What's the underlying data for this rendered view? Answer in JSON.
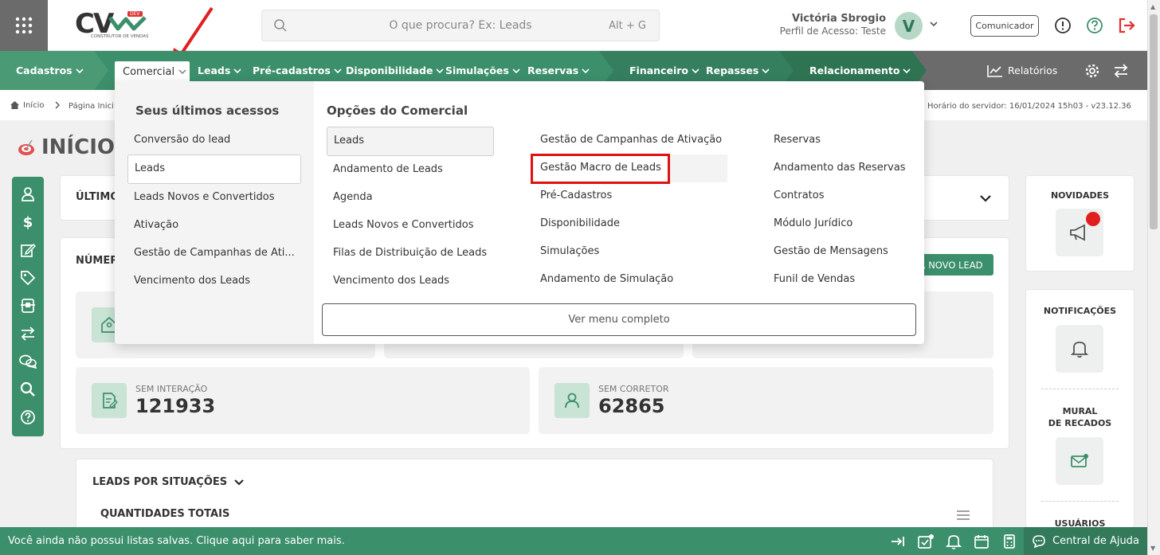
{
  "header": {
    "search_placeholder": "O que procura? Ex: Leads",
    "search_shortcut": "Alt + G",
    "user_name": "Victória Sbrogio",
    "user_profile": "Perfil de Acesso: Teste",
    "avatar_initial": "V",
    "comunicador_label": "Comunicador",
    "logo_text": "CV",
    "logo_badge": "DEV",
    "logo_subtitle": "CONSTRUTOR DE VENDAS"
  },
  "nav": {
    "items": [
      {
        "label": "Cadastros"
      },
      {
        "label": "Comercial"
      },
      {
        "label": "Leads"
      },
      {
        "label": "Pré-cadastros"
      },
      {
        "label": "Disponibilidade"
      },
      {
        "label": "Simulações"
      },
      {
        "label": "Reservas"
      },
      {
        "label": "Financeiro"
      },
      {
        "label": "Repasses"
      },
      {
        "label": "Relacionamento"
      }
    ],
    "reports_label": "Relatórios"
  },
  "breadcrumb": {
    "home": "Início",
    "page": "Página Inici",
    "server_time": "Horário do servidor: 16/01/2024 15h03 - v23.12.36"
  },
  "page": {
    "title": "INÍCIO -",
    "ultimos_label": "ÚLTIMO",
    "numeros_label": "NÚMER",
    "novo_lead_label": "R NOVO LEAD",
    "sem_interacao_label": "SEM INTERAÇÃO",
    "sem_interacao_value": "121933",
    "sem_corretor_label": "SEM CORRETOR",
    "sem_corretor_value": "62865",
    "leads_situacoes_label": "LEADS POR SITUAÇÕES",
    "quantidades_label": "QUANTIDADES TOTAIS"
  },
  "side": {
    "novidades": "NOVIDADES",
    "notificacoes": "NOTIFICAÇÕES",
    "mural_line1": "MURAL",
    "mural_line2": "DE RECADOS",
    "usuarios": "USUÁRIOS"
  },
  "mega_menu": {
    "recent_title": "Seus últimos acessos",
    "recent_items": [
      "Conversão do lead",
      "Leads",
      "Leads Novos e Convertidos",
      "Ativação",
      "Gestão de Campanhas de Ati...",
      "Vencimento dos Leads"
    ],
    "options_title": "Opções do Comercial",
    "col1": [
      "Leads",
      "Andamento de Leads",
      "Agenda",
      "Leads Novos e Convertidos",
      "Filas de Distribuição de Leads",
      "Vencimento dos Leads"
    ],
    "col2": [
      "Gestão de Campanhas de Ativação",
      "Gestão Macro de Leads",
      "Pré-Cadastros",
      "Disponibilidade",
      "Simulações",
      "Andamento de Simulação"
    ],
    "col3": [
      "Reservas",
      "Andamento das Reservas",
      "Contratos",
      "Módulo Jurídico",
      "Gestão de Mensagens",
      "Funil de Vendas"
    ],
    "view_full": "Ver menu completo"
  },
  "bottom": {
    "message": "Você ainda não possui listas salvas. Clique aqui para saber mais.",
    "help_center": "Central de Ajuda"
  },
  "colors": {
    "brand_green": "#3c8f6b",
    "highlight_red": "#dd1111",
    "logout_red": "#e03030"
  }
}
